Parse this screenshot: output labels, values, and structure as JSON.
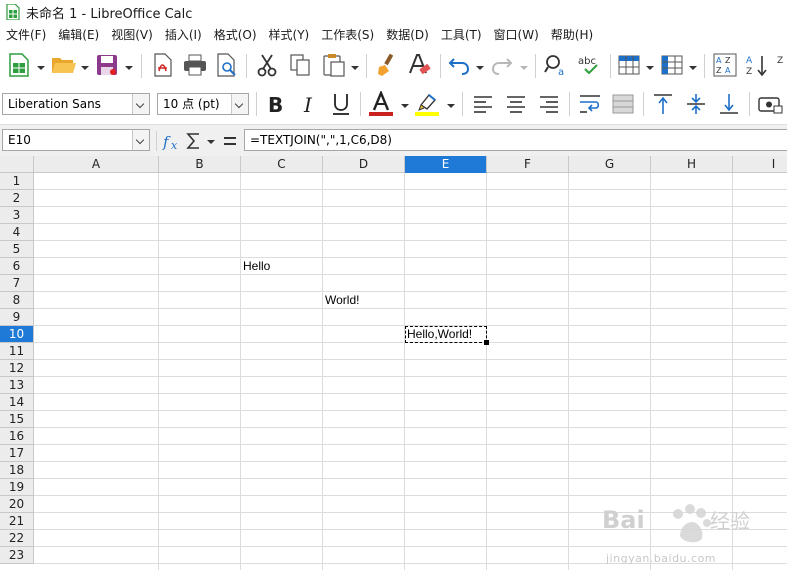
{
  "window": {
    "title": "未命名 1 - LibreOffice Calc"
  },
  "menu": [
    "文件(F)",
    "编辑(E)",
    "视图(V)",
    "插入(I)",
    "格式(O)",
    "样式(Y)",
    "工作表(S)",
    "数据(D)",
    "工具(T)",
    "窗口(W)",
    "帮助(H)"
  ],
  "format_bar": {
    "font_name": "Liberation Sans",
    "font_size": "10 点 (pt)",
    "font_color": "#c9211e",
    "highlight_color": "#ffff00"
  },
  "formula_bar": {
    "cell_ref": "E10",
    "formula": "=TEXTJOIN(\",\",1,C6,D8)"
  },
  "sheet": {
    "columns": [
      "A",
      "B",
      "C",
      "D",
      "E",
      "F",
      "G",
      "H",
      "I"
    ],
    "rows": [
      "1",
      "2",
      "3",
      "4",
      "5",
      "6",
      "7",
      "8",
      "9",
      "10",
      "11",
      "12",
      "13",
      "14",
      "15",
      "16",
      "17",
      "18",
      "19",
      "20",
      "21",
      "22",
      "23"
    ],
    "active_column": "E",
    "active_row": "10",
    "cells": {
      "C6": "Hello",
      "D8": "World!",
      "E10": "Hello,World!"
    }
  },
  "watermark": {
    "text": "jingyan.baidu.com"
  },
  "colors": {
    "accent": "#1e7ad6"
  }
}
